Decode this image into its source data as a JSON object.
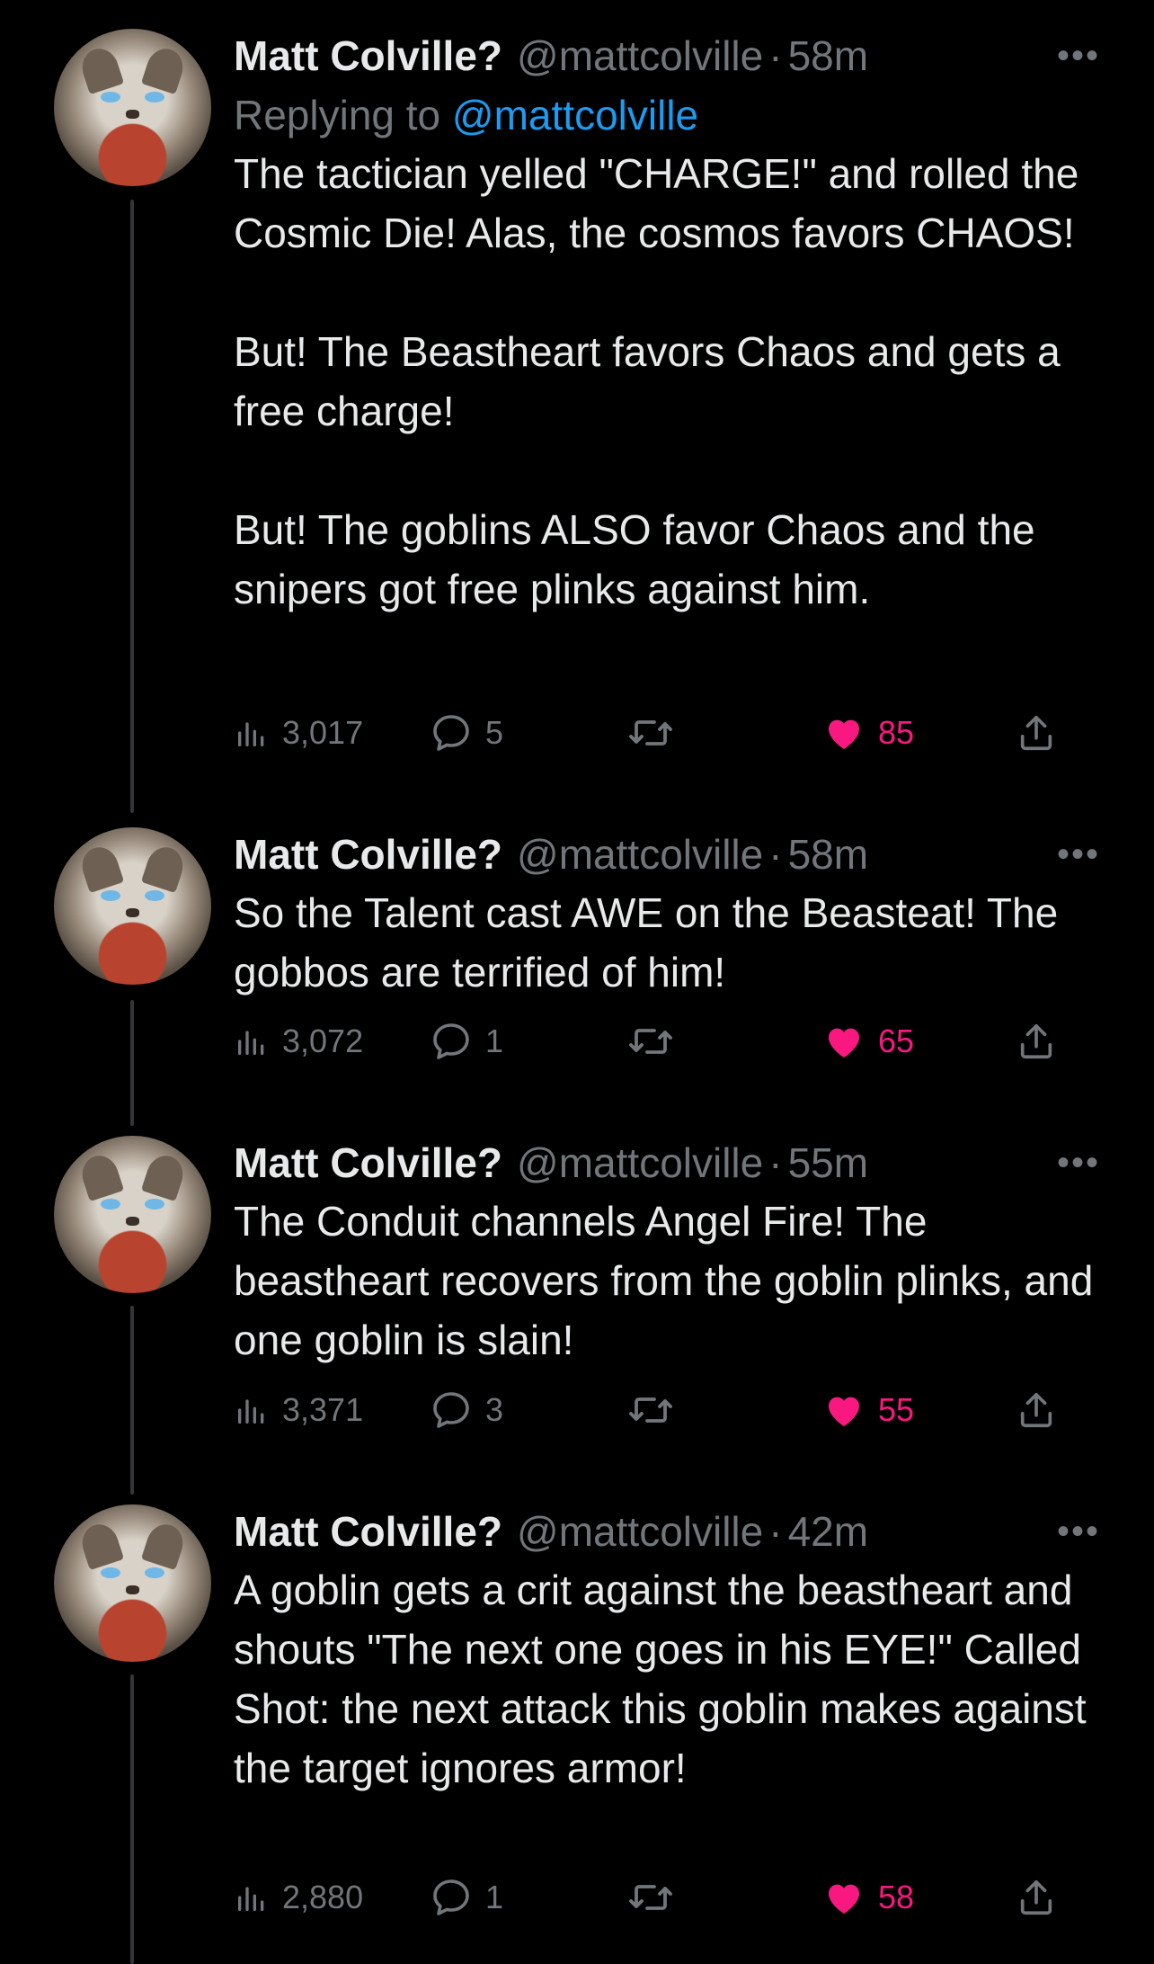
{
  "tweets": [
    {
      "name": "Matt Colville?",
      "handle": "@mattcolville",
      "separator": "·",
      "time": "58m",
      "reply_prefix": "Replying to",
      "reply_to": "@mattcolville",
      "text": "The tactician yelled \"CHARGE!\" and rolled the Cosmic Die! Alas, the cosmos favors CHAOS!\n\nBut! The Beastheart favors Chaos and gets a free charge!\n\nBut! The goblins ALSO favor Chaos and the snipers got free plinks against him.",
      "views": "3,017",
      "replies": "5",
      "likes": "85"
    },
    {
      "name": "Matt Colville?",
      "handle": "@mattcolville",
      "separator": "·",
      "time": "58m",
      "text": "So the Talent cast AWE on the Beasteat! The gobbos are terrified of him!",
      "views": "3,072",
      "replies": "1",
      "likes": "65"
    },
    {
      "name": "Matt Colville?",
      "handle": "@mattcolville",
      "separator": "·",
      "time": "55m",
      "text": "The Conduit channels Angel Fire! The beastheart recovers from the goblin plinks, and one goblin is slain!",
      "views": "3,371",
      "replies": "3",
      "likes": "55"
    },
    {
      "name": "Matt Colville?",
      "handle": "@mattcolville",
      "separator": "·",
      "time": "42m",
      "text": "A goblin gets a crit against the beastheart and shouts \"The next one goes in his EYE!\" Called Shot: the next attack this goblin makes against the target ignores armor!",
      "views": "2,880",
      "replies": "1",
      "likes": "58"
    }
  ],
  "icons": {
    "more": "more-icon",
    "views": "views-icon",
    "reply": "reply-icon",
    "retweet": "retweet-icon",
    "like": "heart-icon",
    "share": "share-icon"
  },
  "colors": {
    "accent": "#1d9bf0",
    "like": "#f91880",
    "muted": "#71767b"
  }
}
